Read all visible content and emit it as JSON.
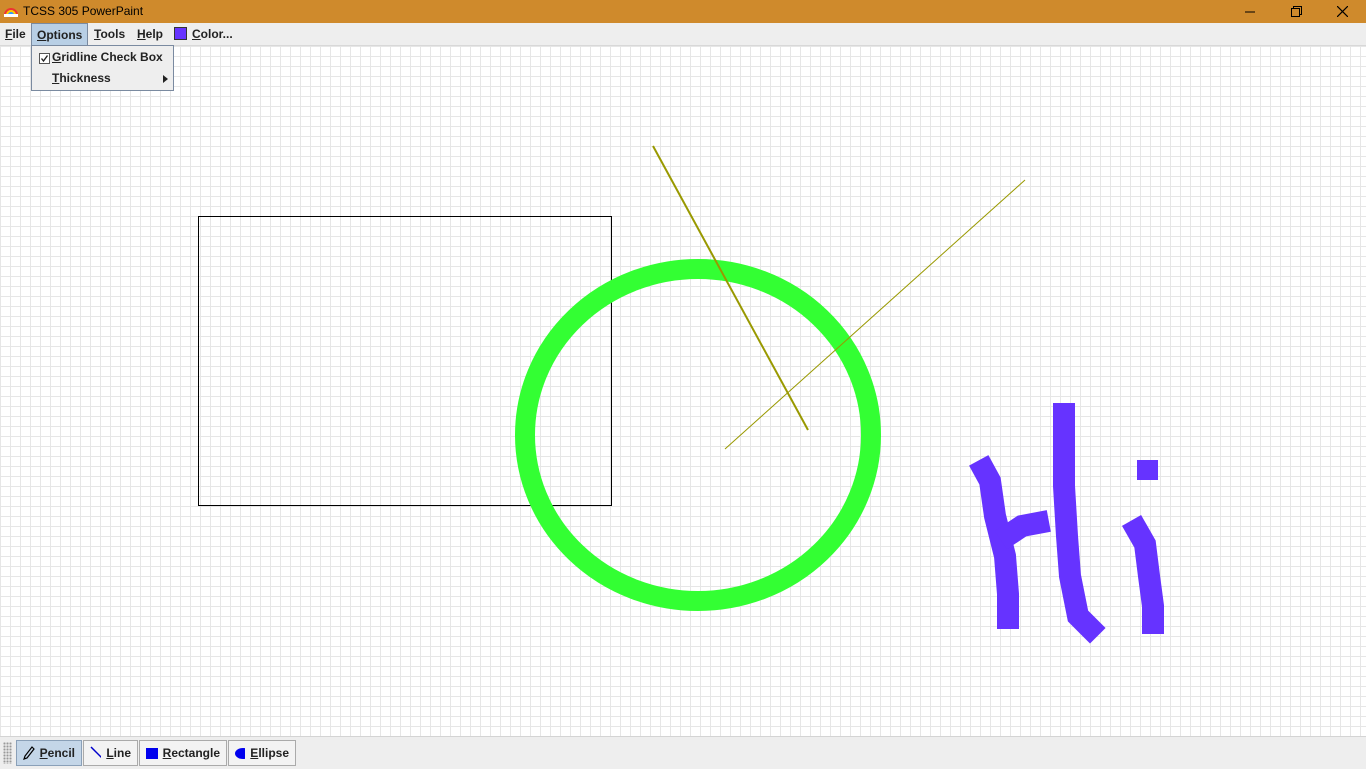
{
  "window": {
    "title": "TCSS 305 PowerPaint"
  },
  "menubar": {
    "file": {
      "pre": "",
      "mnemonic": "F",
      "post": "ile"
    },
    "options": {
      "pre": "",
      "mnemonic": "O",
      "post": "ptions"
    },
    "tools": {
      "pre": "",
      "mnemonic": "T",
      "post": "ools"
    },
    "help": {
      "pre": "",
      "mnemonic": "H",
      "post": "elp"
    },
    "color": {
      "pre": "",
      "mnemonic": "C",
      "post": "olor..."
    },
    "current_color": "#6633ff"
  },
  "options_menu": {
    "gridline": {
      "pre": "",
      "mnemonic": "G",
      "post": "ridline Check Box",
      "checked": true
    },
    "thickness": {
      "pre": "",
      "mnemonic": "T",
      "post": "hickness"
    }
  },
  "toolbar": {
    "pencil": {
      "mnemonic": "P",
      "post": "encil",
      "active": true
    },
    "line": {
      "mnemonic": "L",
      "post": "ine",
      "active": false
    },
    "rectangle": {
      "mnemonic": "R",
      "post": "ectangle",
      "active": false
    },
    "ellipse": {
      "mnemonic": "E",
      "post": "llipse",
      "active": false
    }
  },
  "canvas": {
    "gridlines": true,
    "shape_colors": {
      "rectangle": "#000000",
      "circle": "#33ff33",
      "lines": "#999900",
      "pencil": "#6633ff"
    }
  }
}
